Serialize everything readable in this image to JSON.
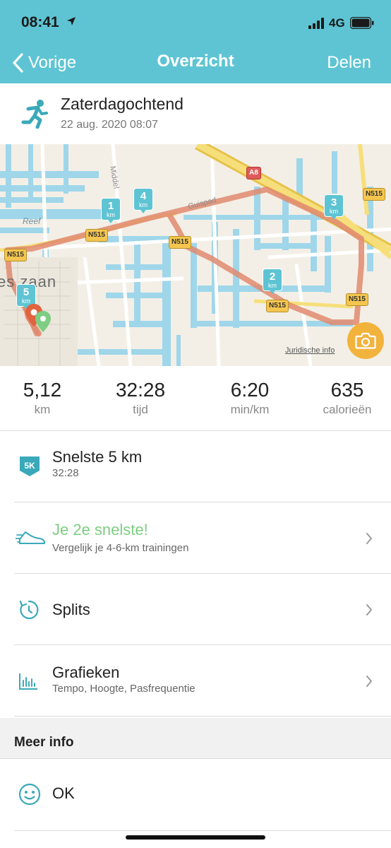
{
  "status_bar": {
    "time": "08:41",
    "network": "4G"
  },
  "nav": {
    "back_label": "Vorige",
    "title": "Overzicht",
    "share_label": "Delen"
  },
  "activity": {
    "name": "Zaterdagochtend",
    "date": "22 aug. 2020 08:07"
  },
  "map": {
    "km_markers": [
      "1",
      "2",
      "3",
      "4",
      "5"
    ],
    "km_unit": "km",
    "roads": [
      "N515",
      "N515",
      "N515",
      "N515",
      "N515",
      "N515",
      "N515"
    ],
    "highway": "A8",
    "labels": {
      "reef": "Reef",
      "town": "es zaan",
      "street1": "Middel",
      "street2": "Guispad"
    },
    "legal": "Juridische info"
  },
  "stats": [
    {
      "value": "5,12",
      "label": "km"
    },
    {
      "value": "32:28",
      "label": "tijd"
    },
    {
      "value": "6:20",
      "label": "min/km"
    },
    {
      "value": "635",
      "label": "calorieën"
    }
  ],
  "rows": {
    "fastest": {
      "title": "Snelste 5 km",
      "subtitle": "32:28",
      "badge": "5K"
    },
    "compare": {
      "title": "Je 2e snelste!",
      "subtitle": "Vergelijk je 4-6-km trainingen"
    },
    "splits": {
      "title": "Splits"
    },
    "charts": {
      "title": "Grafieken",
      "subtitle": "Tempo, Hoogte, Pasfrequentie"
    }
  },
  "more_info": {
    "title": "Meer info",
    "feeling": "OK"
  },
  "colors": {
    "header": "#5ec4d3",
    "accent": "#5ec4d3",
    "route": "#e08a6e",
    "highlight_green": "#7dce82",
    "camera": "#f2b33d"
  }
}
